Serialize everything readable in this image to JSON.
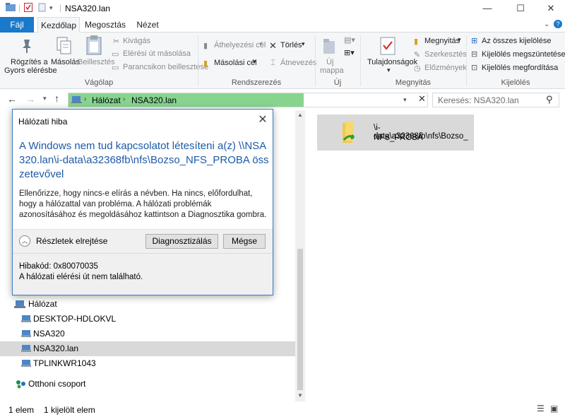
{
  "window": {
    "title": "NSA320.lan"
  },
  "tabs": [
    "Fájl",
    "Kezdőlap",
    "Megosztás",
    "Nézet"
  ],
  "ribbon": {
    "pin_label_1": "Rögzítés a",
    "pin_label_2": "Gyors elérésbe",
    "copy": "Másolás",
    "paste": "Beillesztés",
    "cut": "Kivágás",
    "copy_path": "Elérési út másolása",
    "paste_shortcut": "Parancsikon beillesztése",
    "group_clipboard": "Vágólap",
    "move_to": "Áthelyezési cél",
    "copy_to": "Másolási cél",
    "delete": "Törlés",
    "rename": "Átnevezés",
    "group_organize": "Rendszerezés",
    "new_folder_1": "Új",
    "new_folder_2": "mappa",
    "group_new": "Új",
    "properties": "Tulajdonságok",
    "open": "Megnyitás",
    "edit": "Szerkesztés",
    "history": "Előzmények",
    "group_open": "Megnyitás",
    "select_all": "Az összes kijelölése",
    "select_none": "Kijelölés megszüntetése",
    "invert_selection": "Kijelölés megfordítása",
    "group_select": "Kijelölés"
  },
  "address": {
    "crumbs": [
      "Hálózat",
      "NSA320.lan"
    ],
    "search_placeholder": "Keresés: NSA320.lan"
  },
  "dialog": {
    "title": "Hálózati hiba",
    "heading": "A Windows nem tud kapcsolatot létesíteni a(z) \\\\NSA320.lan\\i-data\\a32368fb\\nfs\\Bozso_NFS_PROBA összetevővel",
    "body": "Ellenőrizze, hogy nincs-e elírás a névben. Ha nincs, előfordulhat, hogy a hálózattal van probléma. A hálózati problémák azonosításához és megoldásához kattintson a Diagnosztika gombra.",
    "details_toggle": "Részletek elrejtése",
    "diagnose_button": "Diagnosztizálás",
    "cancel_button": "Mégse",
    "error_code": "Hibakód: 0x80070035",
    "error_message": "A hálózati elérési út nem található."
  },
  "nav": {
    "network": "Hálózat",
    "items": [
      "DESKTOP-HDLOKVL",
      "NSA320",
      "NSA320.lan",
      "TPLINKWR1043"
    ],
    "homegroup": "Otthoni csoport"
  },
  "files": [
    {
      "name_line1": "\\i-data\\a32368fb\\nfs\\Bozso_",
      "name_line2": "NFS_PROBA"
    }
  ],
  "status": {
    "count": "1 elem",
    "selected": "1 kijelölt elem"
  },
  "colors": {
    "accent": "#1979ca",
    "address_progress": "#87d48f",
    "dialog_heading": "#1c5ba8",
    "selection": "#d9d9d9"
  }
}
